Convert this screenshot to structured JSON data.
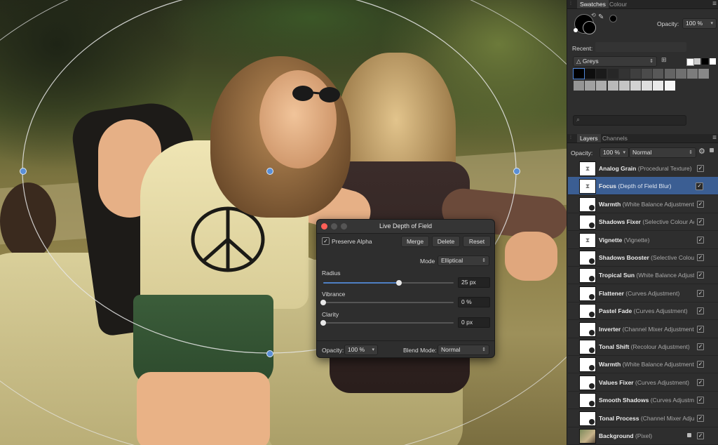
{
  "canvas": {
    "ellipse_color": "#e8e8e8",
    "handle_color": "#5a8fd6"
  },
  "dialog": {
    "title": "Live Depth of Field",
    "preserve_alpha_label": "Preserve Alpha",
    "preserve_alpha_checked": "✓",
    "merge_label": "Merge",
    "delete_label": "Delete",
    "reset_label": "Reset",
    "mode_label": "Mode",
    "mode_value": "Elliptical",
    "radius": {
      "label": "Radius",
      "value": "25 px",
      "fraction": 0.58
    },
    "vibrance": {
      "label": "Vibrance",
      "value": "0 %",
      "fraction": 0.0
    },
    "clarity": {
      "label": "Clarity",
      "value": "0 px",
      "fraction": 0.0
    },
    "opacity_label": "Opacity:",
    "opacity_value": "100 %",
    "blend_label": "Blend Mode:",
    "blend_value": "Normal",
    "close_color": "#ff5f57"
  },
  "swatches": {
    "tabs": [
      "Swatches",
      "Colour"
    ],
    "opacity_label": "Opacity:",
    "opacity_value": "100 %",
    "recent_label": "Recent:",
    "palette_name": "Greys",
    "grey_row1": [
      "#000000",
      "#0e0e0e",
      "#1b1b1b",
      "#272727",
      "#333333",
      "#3f3f3f",
      "#4b4b4b",
      "#585858",
      "#646464",
      "#707070",
      "#7c7c7c",
      "#888888"
    ],
    "grey_row2": [
      "#959595",
      "#a1a1a1",
      "#adadad",
      "#b9b9b9",
      "#c5c5c5",
      "#d2d2d2",
      "#dedede",
      "#eaeaea",
      "#f6f6f6"
    ]
  },
  "layers": {
    "tabs": [
      "Layers",
      "Channels"
    ],
    "opacity_label": "Opacity:",
    "opacity_value": "100 %",
    "blend_value": "Normal",
    "items": [
      {
        "name": "Analog Grain",
        "type": "(Procedural Texture)",
        "icon": "hourglass-icon"
      },
      {
        "name": "Focus",
        "type": "(Depth of Field Blur)",
        "icon": "hourglass-icon",
        "selected": true
      },
      {
        "name": "Warmth",
        "type": "(White Balance Adjustment)",
        "icon": "adjustment-icon"
      },
      {
        "name": "Shadows Fixer",
        "type": "(Selective Colour Ac",
        "icon": "adjustment-icon"
      },
      {
        "name": "Vignette",
        "type": "(Vignette)",
        "icon": "hourglass-icon"
      },
      {
        "name": "Shadows Booster",
        "type": "(Selective Colour",
        "icon": "adjustment-icon"
      },
      {
        "name": "Tropical Sun",
        "type": "(White Balance Adjust",
        "icon": "adjustment-icon"
      },
      {
        "name": "Flattener",
        "type": "(Curves Adjustment)",
        "icon": "adjustment-icon"
      },
      {
        "name": "Pastel Fade",
        "type": "(Curves Adjustment)",
        "icon": "adjustment-icon"
      },
      {
        "name": "Inverter",
        "type": "(Channel Mixer Adjustment",
        "icon": "adjustment-icon"
      },
      {
        "name": "Tonal Shift",
        "type": "(Recolour Adjustment)",
        "icon": "adjustment-icon"
      },
      {
        "name": "Warmth",
        "type": "(White Balance Adjustment",
        "icon": "adjustment-icon"
      },
      {
        "name": "Values Fixer",
        "type": "(Curves Adjustment)",
        "icon": "adjustment-icon"
      },
      {
        "name": "Smooth Shadows",
        "type": "(Curves Adjustm",
        "icon": "adjustment-icon"
      },
      {
        "name": "Tonal Process",
        "type": "(Channel Mixer Adjust",
        "icon": "adjustment-icon"
      },
      {
        "name": "Background",
        "type": "(Pixel)",
        "icon": "photo-thumbnail",
        "locked": true
      }
    ]
  }
}
